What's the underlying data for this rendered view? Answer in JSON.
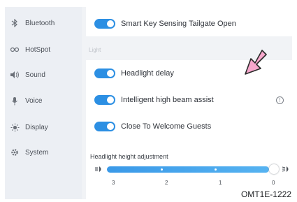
{
  "sidebar": {
    "items": [
      {
        "label": "Bluetooth",
        "icon": "bluetooth-icon"
      },
      {
        "label": "HotSpot",
        "icon": "hotspot-icon"
      },
      {
        "label": "Sound",
        "icon": "sound-icon"
      },
      {
        "label": "Voice",
        "icon": "microphone-icon"
      },
      {
        "label": "Display",
        "icon": "brightness-icon"
      },
      {
        "label": "System",
        "icon": "gear-icon"
      }
    ]
  },
  "main": {
    "top_setting": {
      "label": "Smart Key Sensing Tailgate Open",
      "enabled": true
    },
    "section_label": "Light",
    "settings": [
      {
        "label": "Headlight delay",
        "enabled": true
      },
      {
        "label": "Intelligent high beam assist",
        "enabled": true
      },
      {
        "label": "Close To Welcome Guests",
        "enabled": true
      }
    ],
    "slider": {
      "label": "Headlight height adjustment",
      "ticks": [
        "3",
        "2",
        "1",
        "0"
      ],
      "value": 0
    }
  },
  "colors": {
    "accent": "#2c8fe3",
    "annotation_arrow": "#f49ac4"
  },
  "caption": "OMT1E-1222"
}
